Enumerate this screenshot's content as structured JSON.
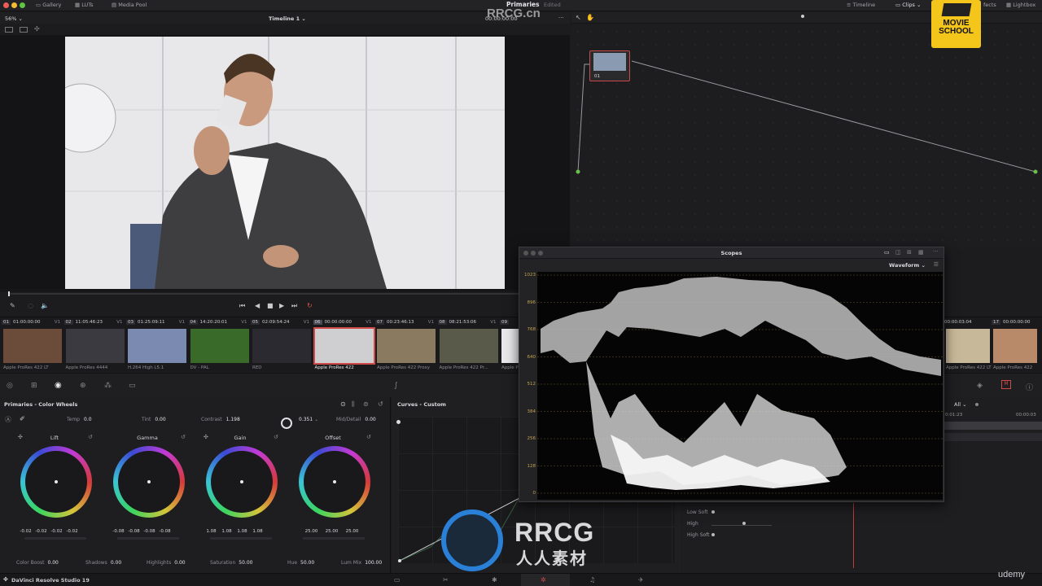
{
  "topbar": {
    "gallery": "Gallery",
    "luts": "LUTs",
    "media_pool": "Media Pool",
    "title": "Primaries",
    "status": "Edited",
    "timeline": "Timeline",
    "clips": "Clips",
    "effects": "fects",
    "lightbox": "Lightbox"
  },
  "viewer": {
    "zoom": "56%",
    "timeline_name": "Timeline 1",
    "timecode": "00:00:00:00"
  },
  "node": {
    "label": "01"
  },
  "clips": [
    {
      "num": "01",
      "tc": "01:00:00:00",
      "track": "V1",
      "label": "Apple ProRes 422 LT"
    },
    {
      "num": "02",
      "tc": "11:05:46:23",
      "track": "V1",
      "label": "Apple ProRes 4444"
    },
    {
      "num": "03",
      "tc": "01:25:09:11",
      "track": "V1",
      "label": "H.264 High L5.1"
    },
    {
      "num": "04",
      "tc": "14:20:20:01",
      "track": "V1",
      "label": "DV - PAL"
    },
    {
      "num": "05",
      "tc": "02:09:54:24",
      "track": "V1",
      "label": "RED"
    },
    {
      "num": "06",
      "tc": "00:00:00:00",
      "track": "V1",
      "label": "Apple ProRes 422"
    },
    {
      "num": "07",
      "tc": "00:23:46:13",
      "track": "V1",
      "label": "Apple ProRes 422 Proxy"
    },
    {
      "num": "08",
      "tc": "08:21:53:06",
      "track": "V1",
      "label": "Apple ProRes 422 Pr..."
    },
    {
      "num": "09",
      "tc": "",
      "track": "",
      "label": "Apple Pro"
    }
  ],
  "clips_right": [
    {
      "num": "",
      "tc": "00:00:03:04",
      "track": "V1",
      "label": "Apple ProRes 422 LT"
    },
    {
      "num": "17",
      "tc": "00:00:00:00",
      "track": "",
      "label": "Apple ProRes 422"
    }
  ],
  "wheels": {
    "title": "Primaries - Color Wheels",
    "temp_label": "Temp",
    "temp": "0.0",
    "tint_label": "Tint",
    "tint": "0.00",
    "contrast_label": "Contrast",
    "contrast": "1.198",
    "pivot": "0.351",
    "mid_label": "Mid/Detail",
    "mid": "0.00",
    "lift": {
      "name": "Lift",
      "values": [
        "-0.02",
        "-0.02",
        "-0.02",
        "-0.02"
      ]
    },
    "gamma": {
      "name": "Gamma",
      "values": [
        "-0.08",
        "-0.08",
        "-0.08",
        "-0.08"
      ]
    },
    "gain": {
      "name": "Gain",
      "values": [
        "1.08",
        "1.08",
        "1.08",
        "1.08"
      ]
    },
    "offset": {
      "name": "Offset",
      "values": [
        "25.00",
        "25.00",
        "25.00"
      ]
    },
    "color_boost_label": "Color Boost",
    "color_boost": "0.00",
    "shadows_label": "Shadows",
    "shadows": "0.00",
    "highlights_label": "Highlights",
    "highlights": "0.00",
    "saturation_label": "Saturation",
    "saturation": "50.00",
    "hue_label": "Hue",
    "hue": "50.00",
    "lum_mix_label": "Lum Mix",
    "lum_mix": "100.00"
  },
  "curves": {
    "title": "Curves - Custom"
  },
  "right": {
    "all": "All",
    "tc": "0:01:23",
    "tc2": "00:00:03",
    "low_soft": "Low Soft",
    "high": "High",
    "high_soft": "High Soft"
  },
  "scopes": {
    "title": "Scopes",
    "mode": "Waveform",
    "ticks": [
      "1023",
      "896",
      "768",
      "640",
      "512",
      "384",
      "256",
      "128",
      "0"
    ]
  },
  "statusbar": {
    "app_name": "DaVinci Resolve Studio 19"
  },
  "overlay": {
    "badge_line1": "MOVIE",
    "badge_line2": "SCHOOL",
    "watermark_top": "RRCG.cn",
    "watermark_logo": "RRCG",
    "watermark_sub": "人人素材",
    "udemy": "udemy"
  },
  "colors": {
    "accent_red": "#d04a4a",
    "scope_tick": "#c2a24a",
    "badge_yellow": "#f4c51a"
  }
}
